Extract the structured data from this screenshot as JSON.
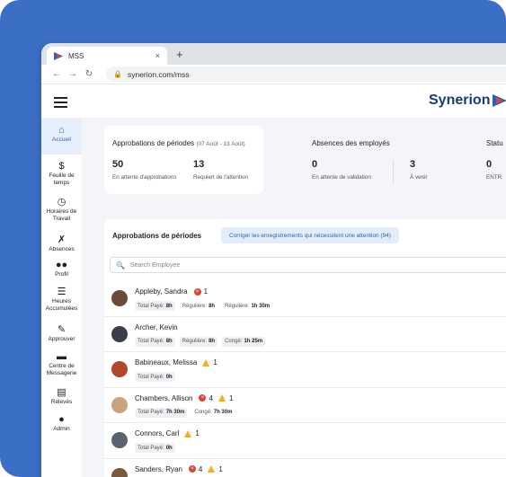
{
  "browser": {
    "tab_title": "MSS",
    "tab_close": "×",
    "new_tab": "+",
    "back": "←",
    "forward": "→",
    "reload": "↻",
    "url": "synerion.com/mss"
  },
  "brand": {
    "name": "Synerion"
  },
  "sidebar": {
    "items": [
      {
        "label": "Accueil",
        "icon": "home-icon",
        "glyph": "⌂"
      },
      {
        "label": "Feuille de temps",
        "icon": "dollar-icon",
        "glyph": "$"
      },
      {
        "label": "Horaires de Travail",
        "icon": "clock-icon",
        "glyph": "◷"
      },
      {
        "label": "Absences",
        "icon": "person-x-icon",
        "glyph": "✗"
      },
      {
        "label": "Profil",
        "icon": "people-icon",
        "glyph": "●●"
      },
      {
        "label": "Heures Accumulées",
        "icon": "list-bank-icon",
        "glyph": "☰"
      },
      {
        "label": "Approuver",
        "icon": "stamp-icon",
        "glyph": "✎"
      },
      {
        "label": "Centre de Messagerie",
        "icon": "chat-icon",
        "glyph": "▬"
      },
      {
        "label": "Relevés",
        "icon": "documents-icon",
        "glyph": "▤"
      },
      {
        "label": "Admin",
        "icon": "admin-person-icon",
        "glyph": "●"
      }
    ]
  },
  "stats": {
    "approvals": {
      "title": "Approbations de périodes",
      "period": "(07 Août - 13 Août)",
      "pending_value": "50",
      "pending_label": "En attente d'approbations",
      "attention_value": "13",
      "attention_label": "Requiert de l'attention"
    },
    "absences": {
      "title": "Absences des employés",
      "validation_value": "0",
      "validation_label": "En attente de validation",
      "upcoming_value": "3",
      "upcoming_label": "À venir"
    },
    "status": {
      "title": "Statu",
      "value": "0",
      "label": "ENTR"
    }
  },
  "panel": {
    "title": "Approbations de périodes",
    "fix_button": "Corriger les enregistrements qui nécessitent une attention (94)",
    "search_placeholder": "Search Employee",
    "search_icon": "🔍"
  },
  "employees": [
    {
      "name": "Appleby, Sandra",
      "errors": "1",
      "warnings": null,
      "avatar_color": "#6b4a3a",
      "chips": [
        {
          "label": "Total Payé:",
          "value": "8h",
          "plain": false
        },
        {
          "label": "Régulière:",
          "value": "8h",
          "plain": true
        },
        {
          "label": "Régulière:",
          "value": "1h 30m",
          "plain": true
        }
      ]
    },
    {
      "name": "Archer, Kevin",
      "errors": null,
      "warnings": null,
      "avatar_color": "#3a3f4a",
      "chips": [
        {
          "label": "Total Payé:",
          "value": "8h",
          "plain": false
        },
        {
          "label": "Régulière:",
          "value": "8h",
          "plain": false
        },
        {
          "label": "Congé:",
          "value": "1h 25m",
          "plain": false
        }
      ]
    },
    {
      "name": "Babineaux, Melissa",
      "errors": null,
      "warnings": "1",
      "avatar_color": "#b3472e",
      "chips": [
        {
          "label": "Total Payé:",
          "value": "0h",
          "plain": false
        }
      ]
    },
    {
      "name": "Chambers, Allison",
      "errors": "4",
      "warnings": "1",
      "avatar_color": "#c9a27e",
      "chips": [
        {
          "label": "Total Payé:",
          "value": "7h 30m",
          "plain": false
        },
        {
          "label": "Congé:",
          "value": "7h 30m",
          "plain": true
        }
      ]
    },
    {
      "name": "Connors, Carl",
      "errors": null,
      "warnings": "1",
      "avatar_color": "#5a6470",
      "chips": [
        {
          "label": "Total Payé:",
          "value": "0h",
          "plain": false
        }
      ]
    },
    {
      "name": "Sanders, Ryan",
      "errors": "4",
      "warnings": "1",
      "avatar_color": "#7a5a3e",
      "chips": []
    }
  ],
  "colors": {
    "background_blue": "#3b6fc6",
    "accent_blue": "#2f5fb5",
    "error_red": "#d9453b",
    "warning_yellow": "#f2b21b",
    "brand_navy": "#1b3a7a"
  }
}
